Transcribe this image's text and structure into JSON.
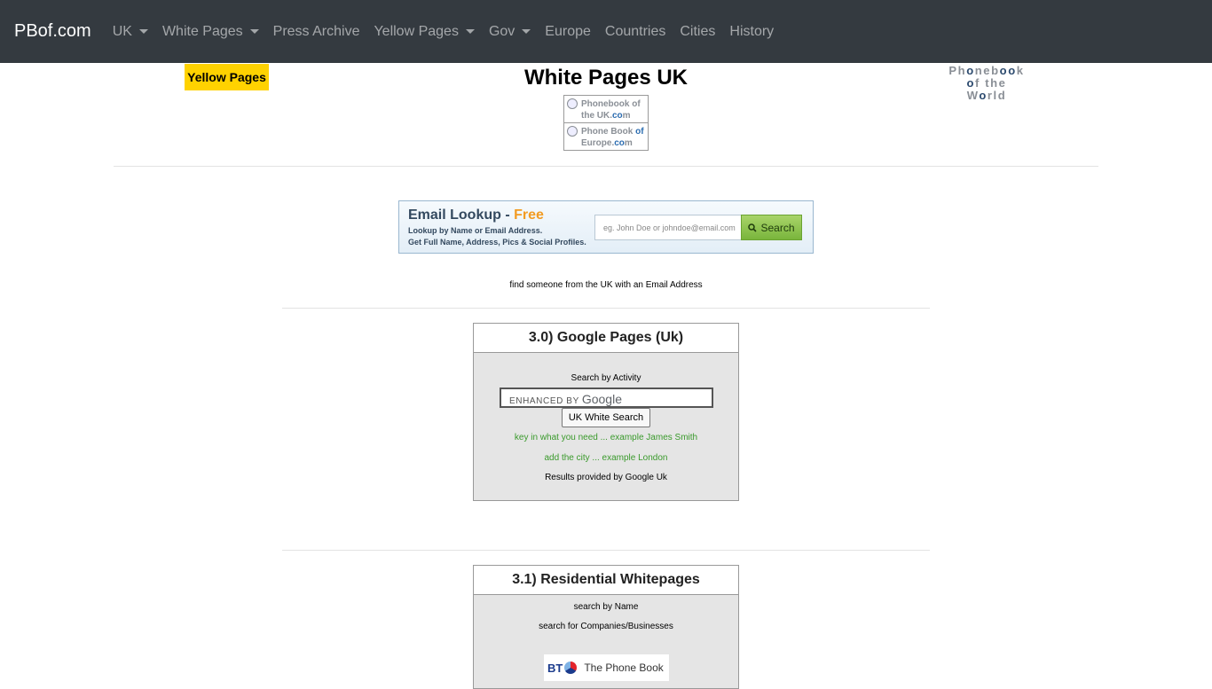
{
  "nav": {
    "brand": "PBof.com",
    "items": [
      {
        "label": "UK",
        "dropdown": true
      },
      {
        "label": "White Pages",
        "dropdown": true
      },
      {
        "label": "Press Archive",
        "dropdown": false
      },
      {
        "label": "Yellow Pages",
        "dropdown": true
      },
      {
        "label": "Gov",
        "dropdown": true
      },
      {
        "label": "Europe",
        "dropdown": false
      },
      {
        "label": "Countries",
        "dropdown": false
      },
      {
        "label": "Cities",
        "dropdown": false
      },
      {
        "label": "History",
        "dropdown": false
      }
    ]
  },
  "header": {
    "yellow_pages_badge": "Yellow Pages",
    "title": "White Pages UK",
    "logo_line1_a": "Ph",
    "logo_line1_o1": "o",
    "logo_line1_b": "neb",
    "logo_line1_o2": "oo",
    "logo_line1_c": "k",
    "logo_line2_o1": "o",
    "logo_line2_b": "f the W",
    "logo_line2_o2": "o",
    "logo_line2_c": "rld",
    "mini_logo_uk": {
      "line1": "Phonebook of",
      "line2_a": "the UK.",
      "line2_c": "co",
      "line2_b": "m"
    },
    "mini_logo_europe": {
      "line1_a": "Phone Book ",
      "line1_b": "of",
      "line2_a": "Europe.",
      "line2_c": "co",
      "line2_b": "m"
    }
  },
  "email_lookup": {
    "title": "Email Lookup",
    "dash": " - ",
    "free": "Free",
    "line1": "Lookup by Name or Email Address.",
    "line2": "Get Full Name, Address, Pics & Social Profiles.",
    "placeholder": "eg. John Doe or johndoe@email.com",
    "button": "Search",
    "caption": "find someone from the UK with an Email Address"
  },
  "google_box": {
    "heading": "3.0) Google Pages (Uk)",
    "search_by": "Search by Activity",
    "enhanced_by": "ENHANCED BY",
    "google": "Google",
    "button": "UK White Search",
    "hint1": "key in what you need ... example James Smith",
    "hint2": "add the city ... example London",
    "provided": "Results provided by Google Uk"
  },
  "residential_box": {
    "heading": "3.1) Residential Whitepages",
    "line1": "search by Name",
    "line2": "search for Companies/Businesses",
    "bt_logo": "BT",
    "bt_name": "The Phone Book"
  },
  "colors": {
    "navbar": "#343a40",
    "badge": "#ffd200",
    "green_text": "#3a9a2c",
    "free_orange": "#f29b22"
  }
}
